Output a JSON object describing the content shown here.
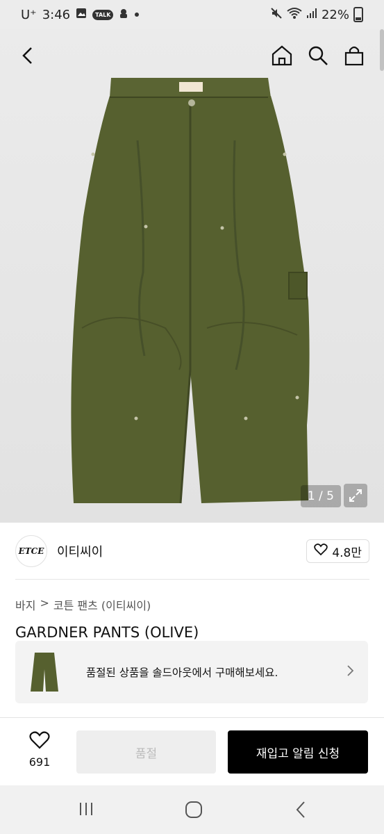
{
  "status_bar": {
    "carrier": "U⁺",
    "time": "3:46",
    "battery": "22%",
    "icons": [
      "image-icon",
      "talk-icon",
      "lock-icon",
      "dot-icon",
      "mute-icon",
      "wifi-icon",
      "signal-icon",
      "battery-icon"
    ],
    "talk_label": "TALK"
  },
  "top_nav": {
    "icons": [
      "back-icon",
      "home-icon",
      "search-icon",
      "cart-icon"
    ]
  },
  "image": {
    "counter": "1 / 5",
    "pants_color": "#56602f"
  },
  "brand": {
    "logo_text": "ETCE",
    "name": "이티씨이",
    "like_count": "4.8만"
  },
  "breadcrumb": {
    "category": "바지",
    "separator": ">",
    "subcategory": "코튼 팬츠 (이티씨이)"
  },
  "product": {
    "title": "GARDNER PANTS (OLIVE)"
  },
  "soldout_banner": {
    "text": "품절된 상품을 솔드아웃에서 구매해보세요."
  },
  "bottom_bar": {
    "wish_count": "691",
    "soldout_label": "품절",
    "restock_label": "재입고 알림 신청"
  },
  "android_nav": {
    "icons": [
      "recent-apps-icon",
      "home-circle-icon",
      "back-nav-icon"
    ]
  }
}
